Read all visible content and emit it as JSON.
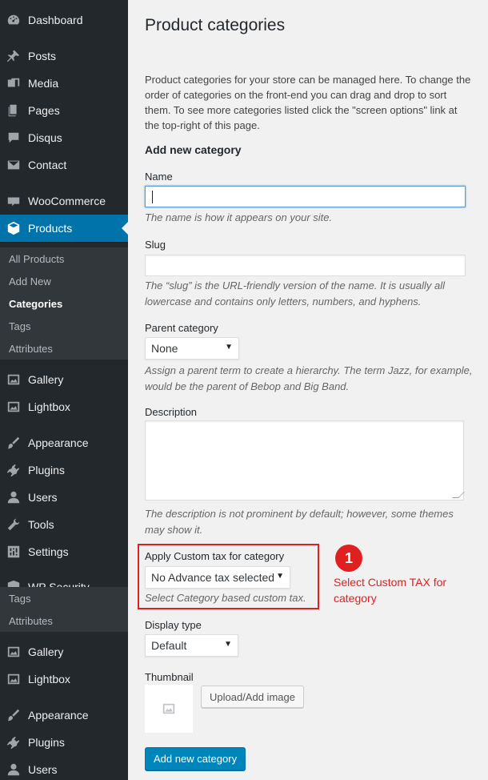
{
  "sidebar": {
    "items": [
      {
        "label": "Dashboard",
        "icon": "dashboard-icon"
      },
      {
        "label": "Posts",
        "icon": "pin-icon"
      },
      {
        "label": "Media",
        "icon": "media-icon"
      },
      {
        "label": "Pages",
        "icon": "pages-icon"
      },
      {
        "label": "Disqus",
        "icon": "comment-icon"
      },
      {
        "label": "Contact",
        "icon": "mail-icon"
      },
      {
        "label": "WooCommerce",
        "icon": "woo-icon"
      },
      {
        "label": "Products",
        "icon": "box-icon",
        "active": true
      },
      {
        "label": "Gallery",
        "icon": "gallery-icon"
      },
      {
        "label": "Lightbox",
        "icon": "lightbox-icon"
      },
      {
        "label": "Appearance",
        "icon": "brush-icon"
      },
      {
        "label": "Plugins",
        "icon": "plugin-icon"
      },
      {
        "label": "Users",
        "icon": "user-icon"
      },
      {
        "label": "Tools",
        "icon": "wrench-icon"
      },
      {
        "label": "Settings",
        "icon": "settings-icon"
      },
      {
        "label": "WP Security",
        "icon": "shield-icon"
      }
    ],
    "products_submenu": [
      "All Products",
      "Add New",
      "Categories",
      "Tags",
      "Attributes"
    ],
    "repeat_submenu": [
      "Tags",
      "Attributes"
    ],
    "repeat_items": [
      {
        "label": "Gallery",
        "icon": "gallery-icon"
      },
      {
        "label": "Lightbox",
        "icon": "lightbox-icon"
      },
      {
        "label": "Appearance",
        "icon": "brush-icon"
      },
      {
        "label": "Plugins",
        "icon": "plugin-icon"
      },
      {
        "label": "Users",
        "icon": "user-icon"
      }
    ]
  },
  "main": {
    "title": "Product categories",
    "intro": "Product categories for your store can be managed here. To change the order of categories on the front-end you can drag and drop to sort them. To see more categories listed click the \"screen options\" link at the top-right of this page.",
    "section_title": "Add new category",
    "name_label": "Name",
    "name_value": "",
    "name_hint": "The name is how it appears on your site.",
    "slug_label": "Slug",
    "slug_value": "",
    "slug_hint": "The “slug” is the URL-friendly version of the name. It is usually all lowercase and contains only letters, numbers, and hyphens.",
    "parent_label": "Parent category",
    "parent_value": "None",
    "parent_hint": "Assign a parent term to create a hierarchy. The term Jazz, for example, would be the parent of Bebop and Big Band.",
    "description_label": "Description",
    "description_hint": "The description is not prominent by default; however, some themes may show it.",
    "custom_tax_label": "Apply Custom tax for category",
    "custom_tax_value": "No Advance tax selected",
    "custom_tax_hint": "Select Category based custom tax.",
    "display_label": "Display type",
    "display_value": "Default",
    "thumbnail_label": "Thumbnail",
    "upload_button": "Upload/Add image",
    "submit_button": "Add new category"
  },
  "annotation": {
    "number": "1",
    "text": "Select Custom TAX for category",
    "color": "#e02020"
  }
}
